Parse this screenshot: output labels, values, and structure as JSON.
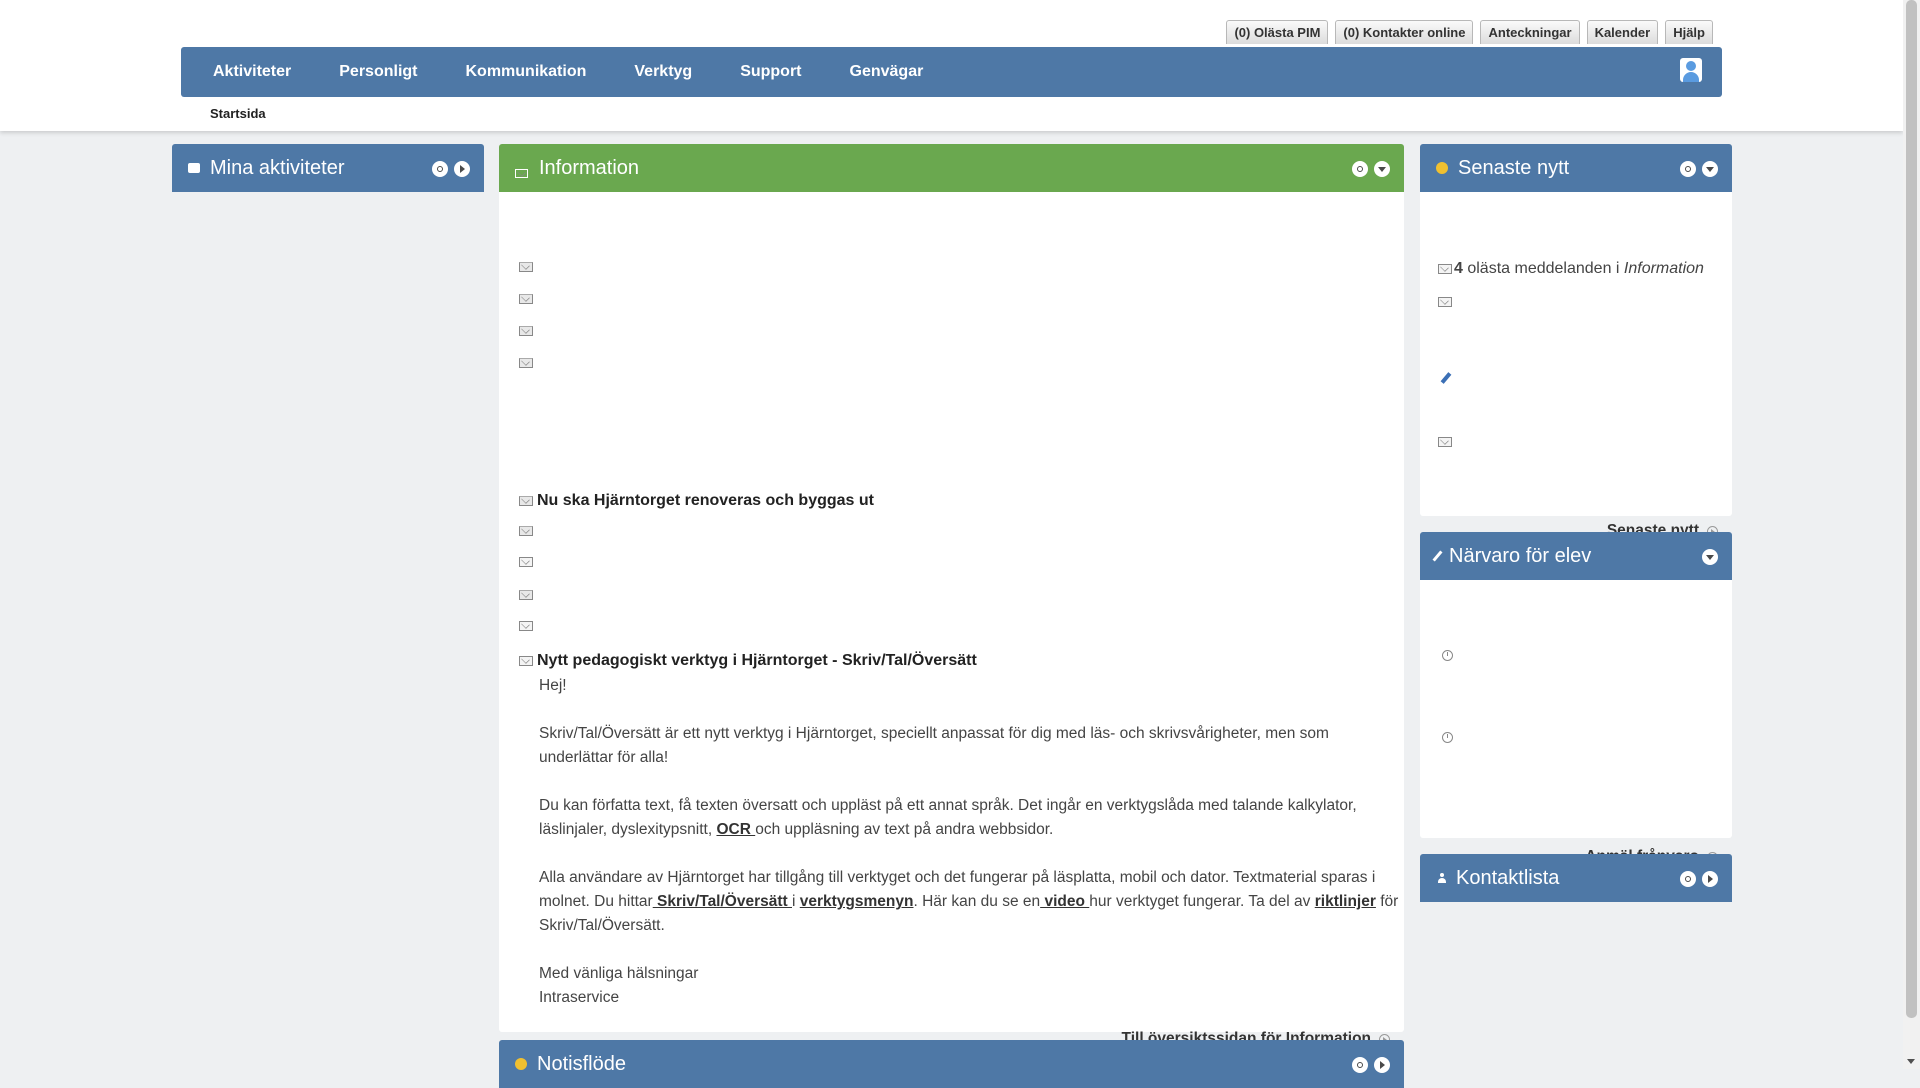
{
  "toplinks": [
    "(0) Olästa PIM",
    "(0) Kontakter online",
    "Anteckningar",
    "Kalender",
    "Hjälp"
  ],
  "nav": [
    "Aktiviteter",
    "Personligt",
    "Kommunikation",
    "Verktyg",
    "Support",
    "Genvägar"
  ],
  "breadcrumb": "Startsida",
  "panels": {
    "mina": {
      "title": "Mina aktiviteter"
    },
    "info": {
      "title": "Information",
      "item1_title": "Nu ska Hjärntorget renoveras och byggas ut",
      "item2_title": "Nytt pedagogiskt verktyg i Hjärntorget - Skriv/Tal/Översätt",
      "msg": {
        "greeting": "Hej!",
        "p1": "Skriv/Tal/Översätt är ett nytt verktyg i Hjärntorget, speciellt anpassat för dig med läs- och skrivsvårigheter, men som underlättar för alla!",
        "p2a": "Du kan författa text, få texten översatt och uppläst på ett annat språk. Det ingår en verktygslåda med talande kalkylator, läslinjaler, dyslexitypsnitt, ",
        "p2_link": "OCR ",
        "p2b": "och uppläsning av text på andra webbsidor.",
        "p3a": "Alla användare av Hjärntorget har tillgång till verktyget och det fungerar på läsplatta, mobil och dator. Textmaterial sparas i molnet. Du hittar",
        "p3_link1": " Skriv/Tal/Översätt ",
        "p3b": "i ",
        "p3_link2": "verktygsmenyn",
        "p3c": ". Här kan du se en",
        "p3_link3": " video ",
        "p3d": "hur verktyget fungerar. Ta del av ",
        "p3_link4": "riktlinjer",
        "p3e": " för Skriv/Tal/Översätt.",
        "sign1": "Med vänliga hälsningar",
        "sign2": "Intraservice"
      },
      "footer_link": "Till översiktssidan för Information"
    },
    "notis": {
      "title": "Notisflöde"
    },
    "senaste": {
      "title": "Senaste nytt",
      "unread_count": "4",
      "unread_text": " olästa meddelanden i ",
      "unread_where": "Information",
      "footer_link": "Senaste nytt"
    },
    "narvaro": {
      "title": "Närvaro för elev",
      "footer_link": "Anmäl frånvaro"
    },
    "kontakt": {
      "title": "Kontaktlista"
    }
  },
  "colors": {
    "nav_blue": "#4e78a6",
    "info_green": "#6aa84f"
  }
}
